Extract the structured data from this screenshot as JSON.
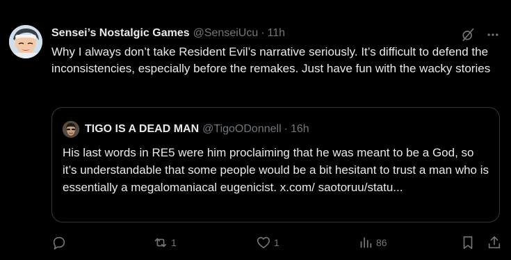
{
  "post": {
    "author_name": "Sensei’s Nostalgic Games",
    "author_handle": "@SenseiUcu",
    "separator": "·",
    "time": "11h",
    "text": "Why I always don’t take Resident Evil’s narrative seriously. It’s difficult to defend the inconsistencies, especially before the remakes. Just have fun with the wacky stories"
  },
  "quote": {
    "author_name": "TIGO IS A DEAD MAN",
    "author_handle": "@TigoODonnell",
    "separator": "·",
    "time": "16h",
    "text": "His last words in RE5 were him proclaiming that he was meant to be a God, so it’s understandable that some people would be a bit hesitant to trust a man who is essentially a megalomaniacal eugenicist. x.com/ saotoruu/statu..."
  },
  "actions": {
    "reply_count": "",
    "repost_count": "1",
    "like_count": "1",
    "views_count": "86"
  },
  "icons": {
    "top": [
      "grok-icon",
      "more-icon"
    ],
    "actions": [
      "reply-icon",
      "repost-icon",
      "like-icon",
      "views-icon",
      "bookmark-icon",
      "share-icon"
    ]
  },
  "colors": {
    "background": "#000000",
    "text_primary": "#e7e9ea",
    "text_secondary": "#71767b",
    "border": "#333639"
  }
}
